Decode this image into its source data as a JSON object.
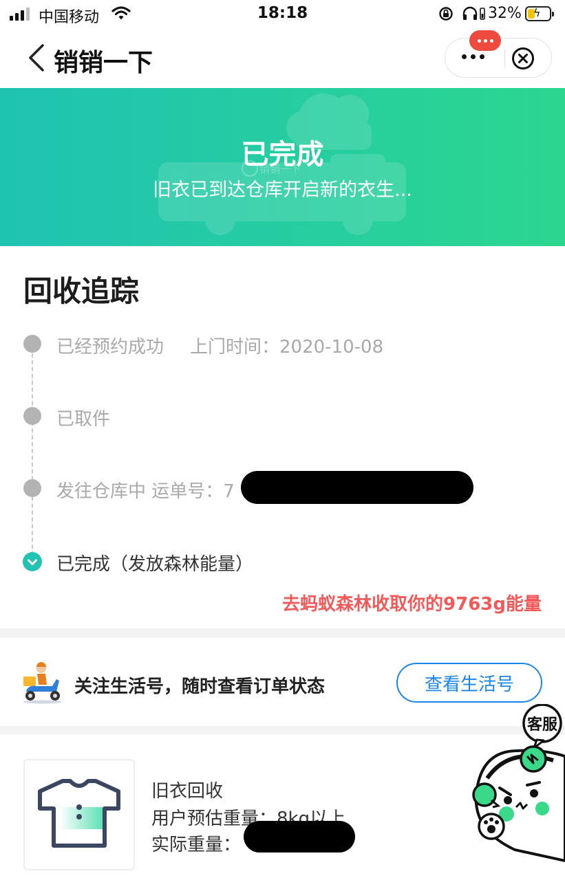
{
  "status_bar": {
    "carrier": "中国移动",
    "time": "18:18",
    "battery_percent": "32%",
    "battery_level": 0.32,
    "battery_color": "#f5c400"
  },
  "nav": {
    "title": "销销一下",
    "back_icon": "chevron-left-icon",
    "more_icon": "more-dots-icon",
    "close_icon": "close-circle-icon",
    "badge_color": "#ee4b3f"
  },
  "banner": {
    "title": "已完成",
    "subtitle": "旧衣已到达仓库开启新的衣生...",
    "watermark": "销销一下",
    "gradient": [
      "#1fc3b2",
      "#2cd68f"
    ]
  },
  "tracking": {
    "title": "回收追踪",
    "steps": [
      {
        "label": "已经预约成功",
        "extra": "上门时间：2020-10-08",
        "status": "done"
      },
      {
        "label": "已取件",
        "extra": "",
        "status": "done"
      },
      {
        "label": "发往仓库中 运单号：7",
        "extra": "",
        "status": "done"
      },
      {
        "label": "已完成（发放森林能量）",
        "extra": "",
        "status": "current"
      }
    ],
    "energy_link": "去蚂蚁森林收取你的9763g能量",
    "accent_color": "#23c2b3",
    "link_color": "#f25a5a"
  },
  "follow": {
    "text": "关注生活号，随时查看订单状态",
    "button": "查看生活号",
    "button_color": "#1b85ea",
    "icon": "delivery-scooter-icon"
  },
  "product": {
    "icon": "tshirt-icon",
    "name": "旧衣回收",
    "estimate": "用户预估重量：8kg以上",
    "actual_label": "实际重量："
  },
  "customer_service": {
    "label": "客服",
    "icon": "mascot-icon"
  }
}
